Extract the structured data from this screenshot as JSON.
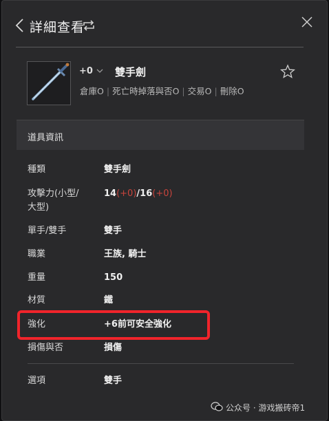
{
  "header": {
    "title": "詳細查看",
    "back_icon": "chevron-left-icon",
    "refresh_icon": "refresh-icon",
    "close_icon": "close-icon"
  },
  "item": {
    "enhance": "+0",
    "name": "雙手劍",
    "flags": [
      "倉庫O",
      "死亡時掉落與否O",
      "交易O",
      "刪除O"
    ],
    "favorite_icon": "star-outline-icon"
  },
  "section": {
    "title": "道具資訊"
  },
  "rows": {
    "type": {
      "label": "種類",
      "value": "雙手劍"
    },
    "attack": {
      "label_line1": "攻擊力(小型/",
      "label_line2": "大型)",
      "small": "14",
      "small_bonus": "(+0)",
      "slash": "/",
      "large": "16",
      "large_bonus": "(+0)"
    },
    "hand": {
      "label": "單手/雙手",
      "value": "雙手"
    },
    "job": {
      "label": "職業",
      "value": "王族, 騎士"
    },
    "weight": {
      "label": "重量",
      "value": "150"
    },
    "material": {
      "label": "材質",
      "value": "鐵"
    },
    "enchant": {
      "label": "強化",
      "value": "+6前可安全強化"
    },
    "damage": {
      "label": "損傷與否",
      "value": "損傷"
    },
    "option": {
      "label": "選項",
      "value": "雙手"
    }
  },
  "watermark": {
    "text": "公众号 · 游戏搬砖帝1"
  },
  "colors": {
    "highlight": "#f0242b",
    "bonus_red": "#c8443c",
    "panel": "#29292b"
  }
}
